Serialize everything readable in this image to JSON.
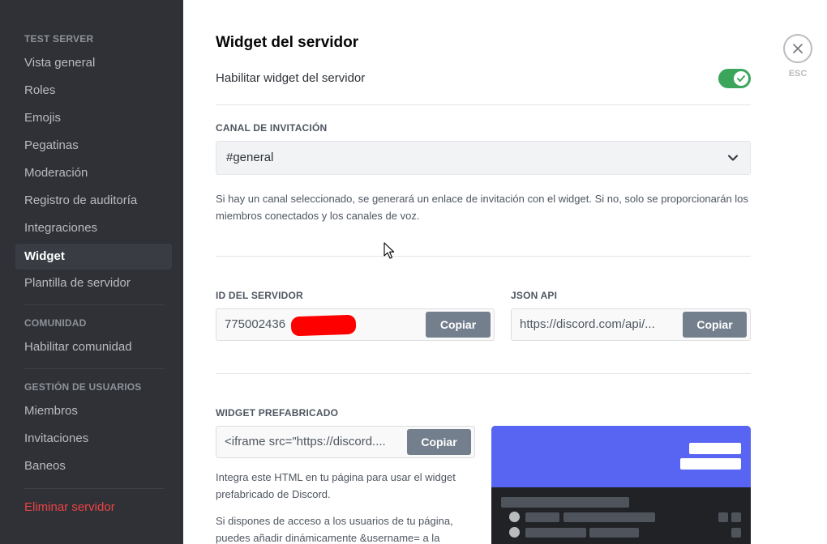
{
  "sidebar": {
    "sections": {
      "server": "TEST SERVER",
      "community": "COMUNIDAD",
      "users": "GESTIÓN DE USUARIOS"
    },
    "items": {
      "overview": "Vista general",
      "roles": "Roles",
      "emojis": "Emojis",
      "stickers": "Pegatinas",
      "moderation": "Moderación",
      "audit_log": "Registro de auditoría",
      "integrations": "Integraciones",
      "widget": "Widget",
      "template": "Plantilla de servidor",
      "enable_community": "Habilitar comunidad",
      "members": "Miembros",
      "invites": "Invitaciones",
      "bans": "Baneos",
      "delete_server": "Eliminar servidor"
    },
    "selected": "widget"
  },
  "main": {
    "title": "Widget del servidor",
    "enable_label": "Habilitar widget del servidor",
    "enable_on": true,
    "invite_channel_label": "CANAL DE INVITACIÓN",
    "invite_channel_value": "#general",
    "invite_help": "Si hay un canal seleccionado, se generará un enlace de invitación con el widget. Si no, solo se proporcionarán los miembros conectados y los canales de voz.",
    "server_id_label": "ID DEL SERVIDOR",
    "server_id_value": "775002436",
    "json_api_label": "JSON API",
    "json_api_value": "https://discord.com/api/...",
    "premade_label": "WIDGET PREFABRICADO",
    "premade_value": "<iframe src=\"https://discord....",
    "copy_label": "Copiar",
    "premade_desc": "Integra este HTML en tu página para usar el widget prefabricado de Discord.",
    "premade_desc2": "Si dispones de acceso a los usuarios de tu página, puedes añadir dinámicamente &username= a la"
  },
  "close": {
    "esc_label": "ESC"
  },
  "colors": {
    "sidebar_bg": "#2f3136",
    "toggle_on": "#3ba55c",
    "danger": "#ed4245",
    "blurple": "#5865f2",
    "copy_button": "#747f8d",
    "redaction": "#ff0000"
  },
  "icons": [
    "chevron-down-icon",
    "check-icon",
    "close-icon",
    "mouse-cursor-icon"
  ]
}
